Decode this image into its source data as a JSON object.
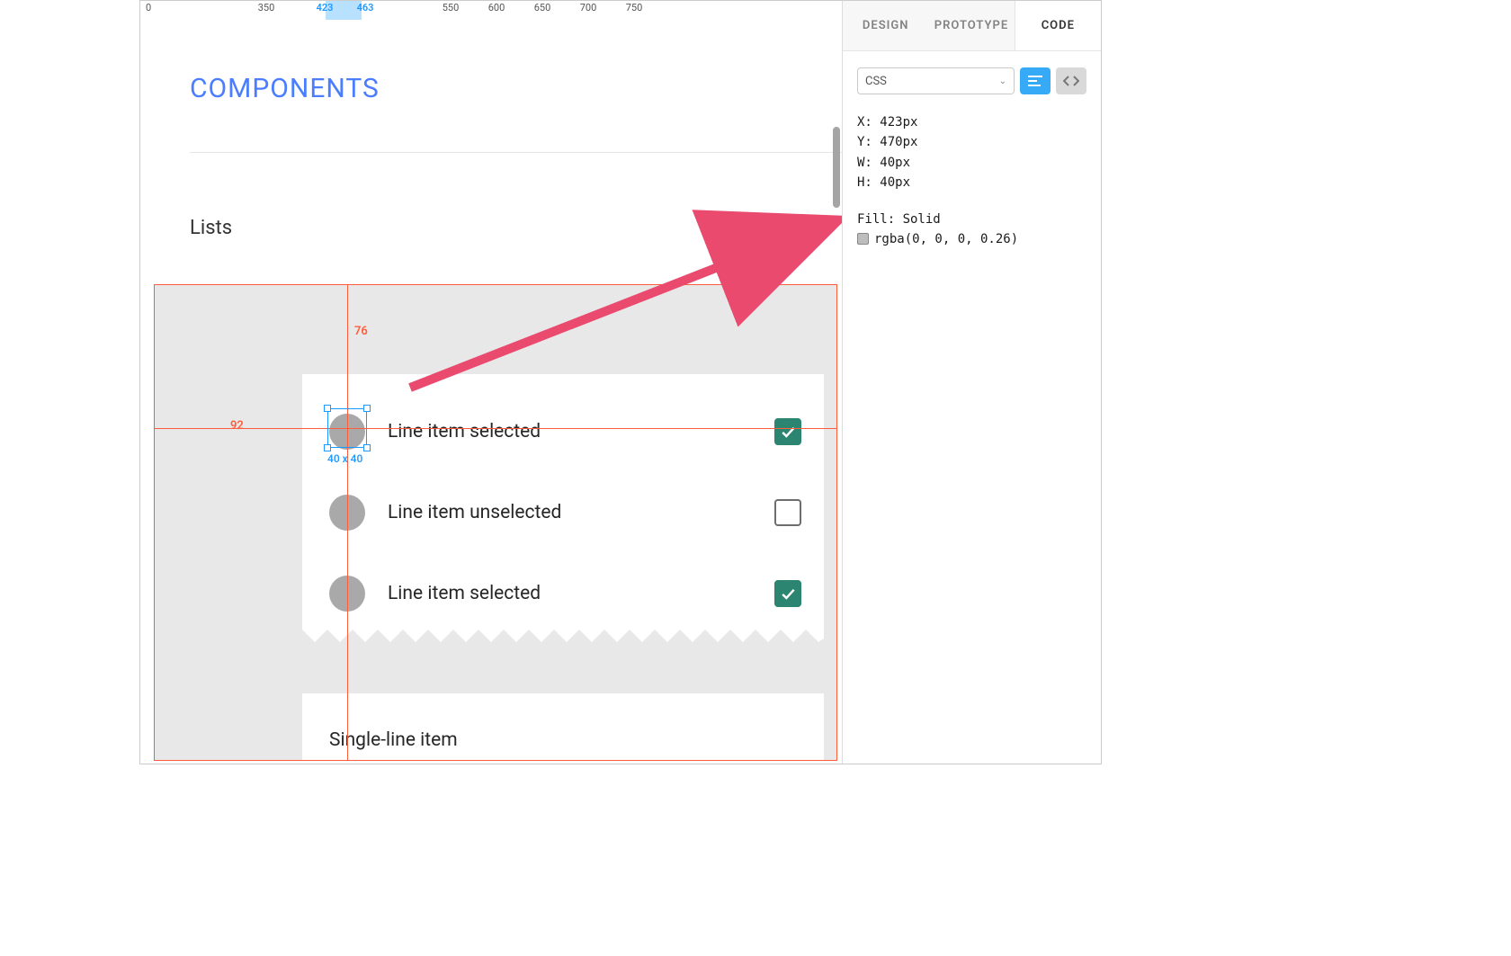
{
  "ruler": {
    "ticks": [
      "0",
      "350",
      "423",
      "463",
      "550",
      "600",
      "650",
      "700",
      "750"
    ],
    "selected_start": "423",
    "selected_end": "463"
  },
  "page_title": "COMPONENTS",
  "section_title": "Lists",
  "list": {
    "rows": [
      {
        "label": "Line item selected",
        "checked": true
      },
      {
        "label": "Line item unselected",
        "checked": false
      },
      {
        "label": "Line item selected",
        "checked": true
      }
    ],
    "single_line": "Single-line item"
  },
  "selection": {
    "size_label": "40 x 40"
  },
  "guides": {
    "top_gap": "76",
    "left_gap": "92"
  },
  "inspector": {
    "tabs": {
      "design": "DESIGN",
      "prototype": "PROTOTYPE",
      "code": "CODE"
    },
    "dropdown_value": "CSS",
    "props": {
      "x": "X: 423px",
      "y": "Y: 470px",
      "w": "W: 40px",
      "h": "H: 40px"
    },
    "fill_label": "Fill: Solid",
    "fill_value": "rgba(0, 0, 0, 0.26)"
  }
}
